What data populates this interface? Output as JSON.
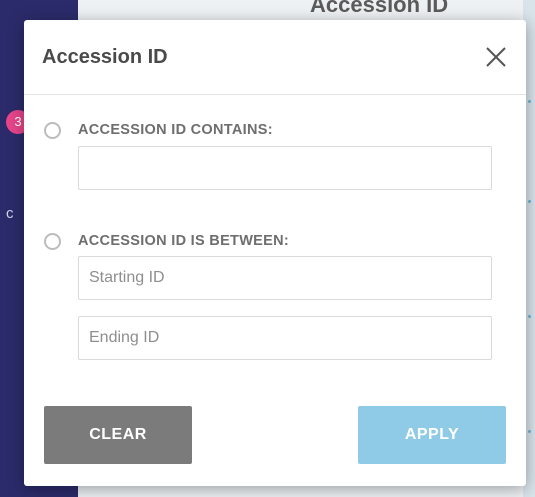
{
  "background": {
    "header_text": "Accession ID",
    "badge_text": "3",
    "sidebar_letter": "c"
  },
  "modal": {
    "title": "Accession ID",
    "close_icon": "close-icon",
    "options": [
      {
        "label": "ACCESSION ID CONTAINS:",
        "selected": false
      },
      {
        "label": "ACCESSION ID IS BETWEEN:",
        "selected": false
      }
    ],
    "contains_input": {
      "value": "",
      "placeholder": ""
    },
    "starting_input": {
      "value": "",
      "placeholder": "Starting ID"
    },
    "ending_input": {
      "value": "",
      "placeholder": "Ending ID"
    },
    "clear_label": "CLEAR",
    "apply_label": "APPLY"
  },
  "colors": {
    "sidebar": "#2b2b6b",
    "badge": "#e8458b",
    "clear_button": "#7b7b7b",
    "apply_button": "#8fcbe6"
  }
}
